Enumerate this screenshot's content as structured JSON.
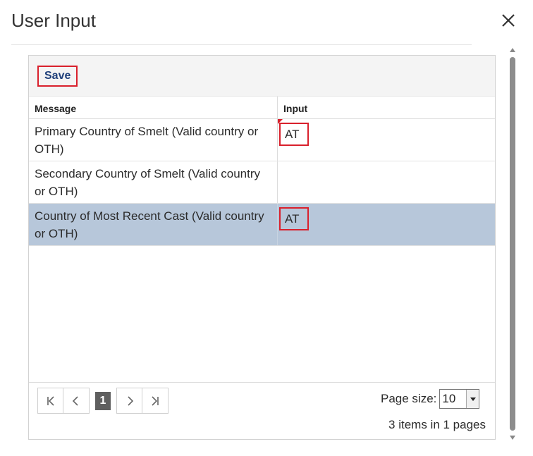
{
  "dialog": {
    "title": "User Input"
  },
  "toolbar": {
    "save_label": "Save"
  },
  "table": {
    "columns": [
      "Message",
      "Input"
    ],
    "rows": [
      {
        "message": "Primary Country of Smelt (Valid country or OTH)",
        "input": "AT"
      },
      {
        "message": "Secondary Country of Smelt (Valid country or OTH)",
        "input": ""
      },
      {
        "message": "Country of Most Recent Cast (Valid country or OTH)",
        "input": "AT"
      }
    ],
    "selected_row": 2
  },
  "pager": {
    "current_page": "1",
    "page_size_label": "Page size:",
    "page_size_value": "10",
    "summary": "3 items in 1 pages"
  },
  "colors": {
    "highlight_border": "#d9202c",
    "selected_row": "#b7c7da",
    "save_text": "#1f3f7a"
  },
  "icons": [
    "close-icon",
    "first-page-icon",
    "previous-page-icon",
    "next-page-icon",
    "last-page-icon",
    "dropdown-arrow-icon"
  ]
}
